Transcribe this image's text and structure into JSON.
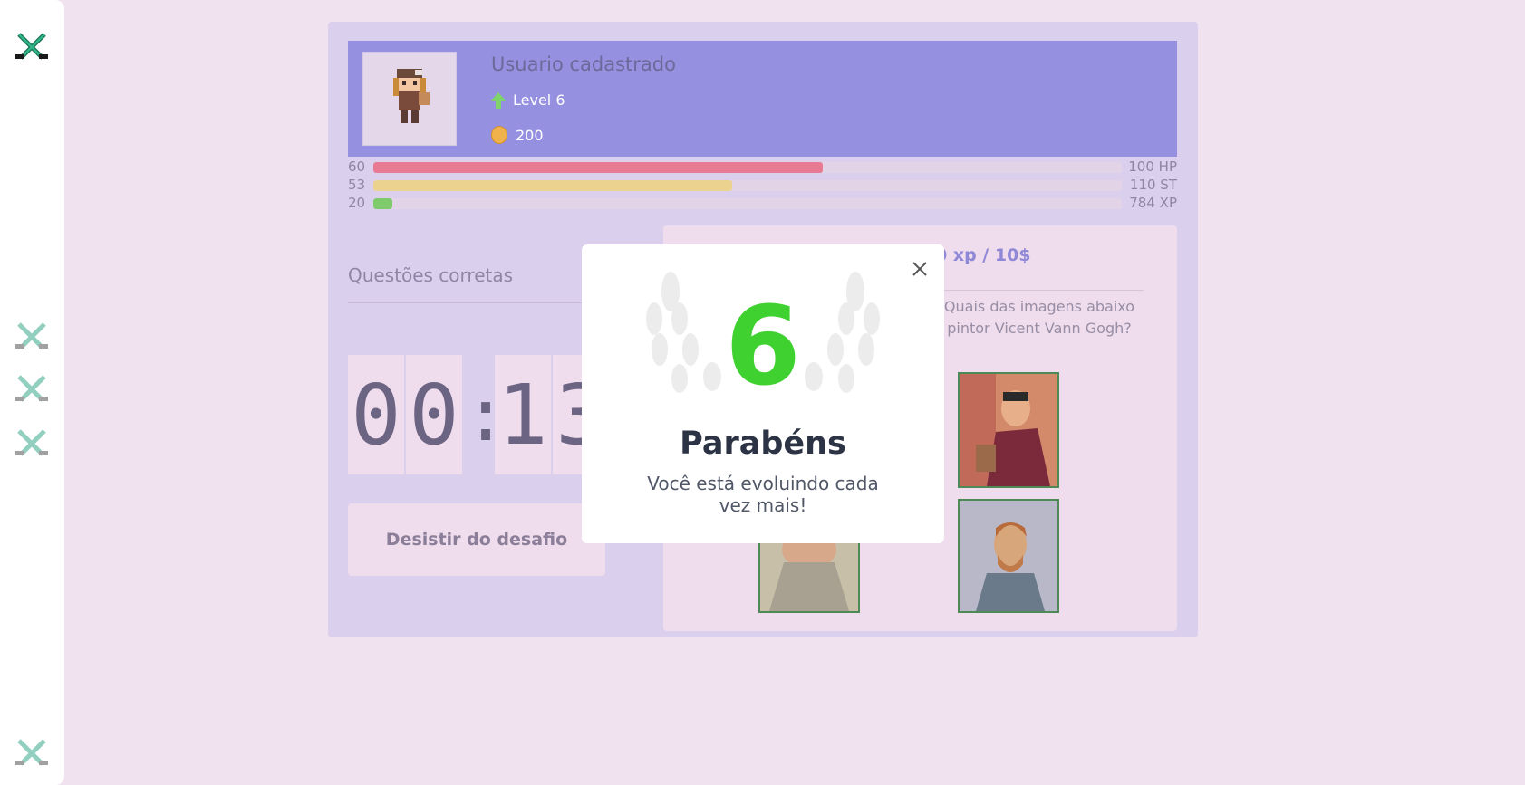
{
  "sidebar": {
    "icons": [
      "swords-icon-active",
      "swords-icon",
      "swords-icon",
      "swords-icon",
      "swords-icon"
    ]
  },
  "profile": {
    "username": "Usuario cadastrado",
    "level": "Level 6",
    "coins": "200"
  },
  "stats": {
    "hp": {
      "current": "60",
      "max": "100 HP",
      "fraction": 0.6,
      "color": "#e87a93"
    },
    "st": {
      "current": "53",
      "max": "110 ST",
      "fraction": 0.48,
      "color": "#ecd28f"
    },
    "xp": {
      "current": "20",
      "max": "784 XP",
      "fraction": 0.025,
      "color": "#7fcb6b"
    }
  },
  "questions": {
    "title": "Questões corretas"
  },
  "timer": {
    "digits": [
      "0",
      "0",
      "1",
      "3"
    ]
  },
  "actions": {
    "giveup_label": "Desistir do desafio"
  },
  "question_card": {
    "reward": "0 xp / 10$",
    "text": "Quais das imagens abaixo pintor Vicent Vann Gogh?"
  },
  "modal": {
    "level_number": "6",
    "title": "Parabéns",
    "subtitle": "Você está evoluindo cada vez mais!"
  },
  "colors": {
    "accent_purple": "#9590e0",
    "level_green": "#3fd12f",
    "background": "#f1e2ef"
  }
}
